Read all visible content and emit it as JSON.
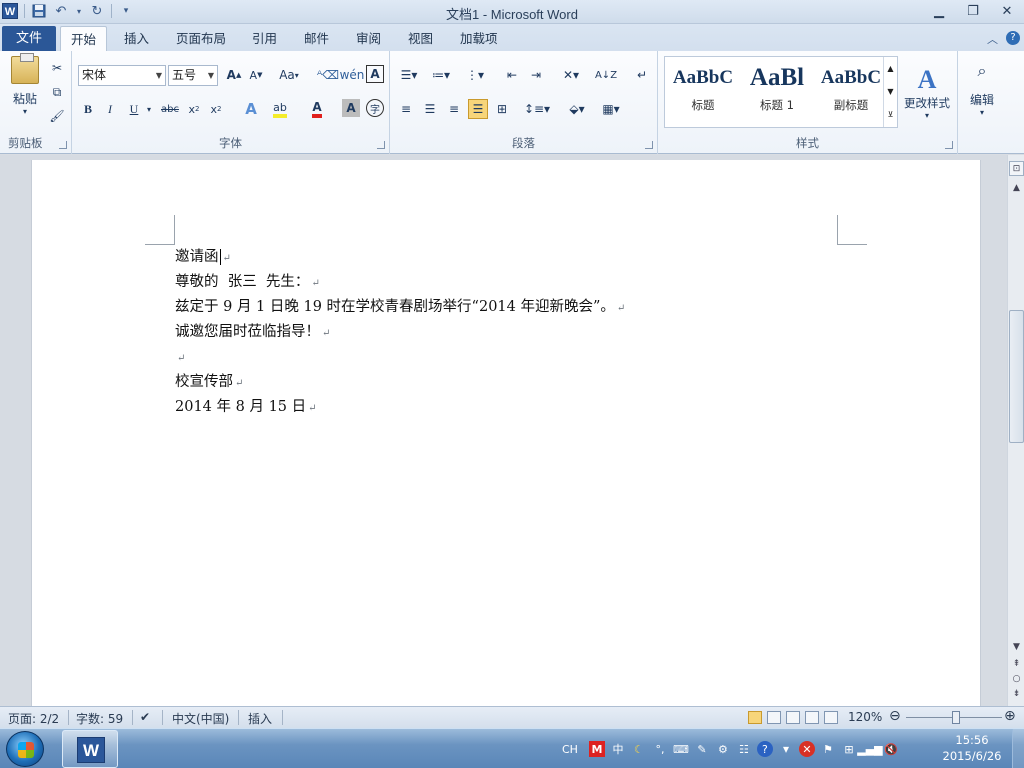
{
  "window": {
    "title": "文档1 - Microsoft Word"
  },
  "tabs": {
    "file": "文件",
    "items": [
      "开始",
      "插入",
      "页面布局",
      "引用",
      "邮件",
      "审阅",
      "视图",
      "加载项"
    ]
  },
  "clipboard": {
    "paste": "粘贴",
    "group": "剪贴板"
  },
  "font": {
    "name": "宋体",
    "size": "五号",
    "group": "字体",
    "aa": "Aa"
  },
  "paragraph": {
    "group": "段落"
  },
  "styles": {
    "group": "样式",
    "items": [
      {
        "preview": "AaBbC",
        "name": "标题"
      },
      {
        "preview": "AaBl",
        "name": "标题 1"
      },
      {
        "preview": "AaBbC",
        "name": "副标题"
      }
    ],
    "change": "更改样式"
  },
  "editing": {
    "label": "编辑"
  },
  "document": {
    "lines": [
      "邀请函",
      "尊敬的  张三  先生：",
      "兹定于 9 月 1 日晚 19 时在学校青春剧场举行“2014 年迎新晚会”。",
      "诚邀您届时莅临指导！",
      "",
      "校宣传部",
      "2014 年 8 月 15 日"
    ]
  },
  "status": {
    "page": "页面: 2/2",
    "words": "字数: 59",
    "language": "中文(中国)",
    "mode": "插入",
    "zoom": "120%"
  },
  "taskbar": {
    "ime": "CH",
    "time": "15:56",
    "date": "2015/6/26"
  }
}
